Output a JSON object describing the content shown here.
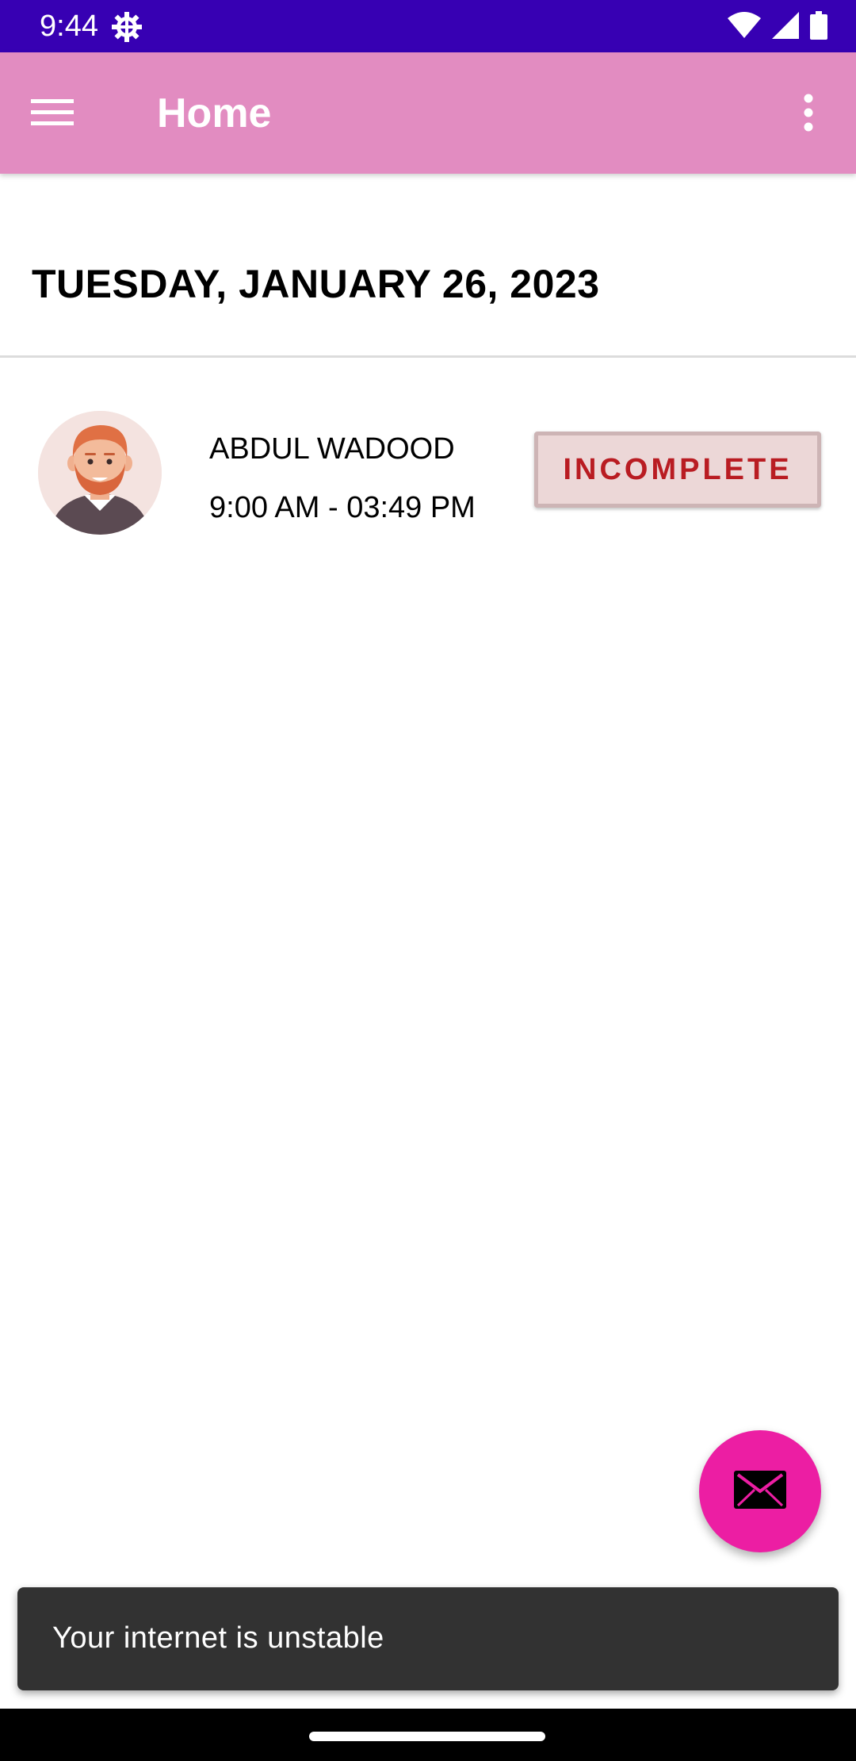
{
  "status_bar": {
    "time": "9:44",
    "icons": [
      "settings-gear-icon",
      "wifi-icon",
      "cell-signal-icon",
      "battery-icon"
    ]
  },
  "app_bar": {
    "title": "Home",
    "menu_icon": "hamburger-menu-icon",
    "overflow_icon": "more-vert-icon"
  },
  "date_header": "TUESDAY, JANUARY 26, 2023",
  "attendance_list": [
    {
      "name": "ABDUL WADOOD",
      "time": "9:00 AM - 03:49 PM",
      "status": "INCOMPLETE",
      "avatar_icon": "avatar-icon"
    }
  ],
  "fab": {
    "icon": "envelope-icon"
  },
  "snackbar": {
    "message": "Your internet is unstable"
  },
  "colors": {
    "status_bar": "#3700b3",
    "app_bar": "#e28cc1",
    "fab": "#ec1ea3",
    "status_text": "#b91c22",
    "status_bg": "#ecd7d7",
    "snackbar": "#323232"
  }
}
